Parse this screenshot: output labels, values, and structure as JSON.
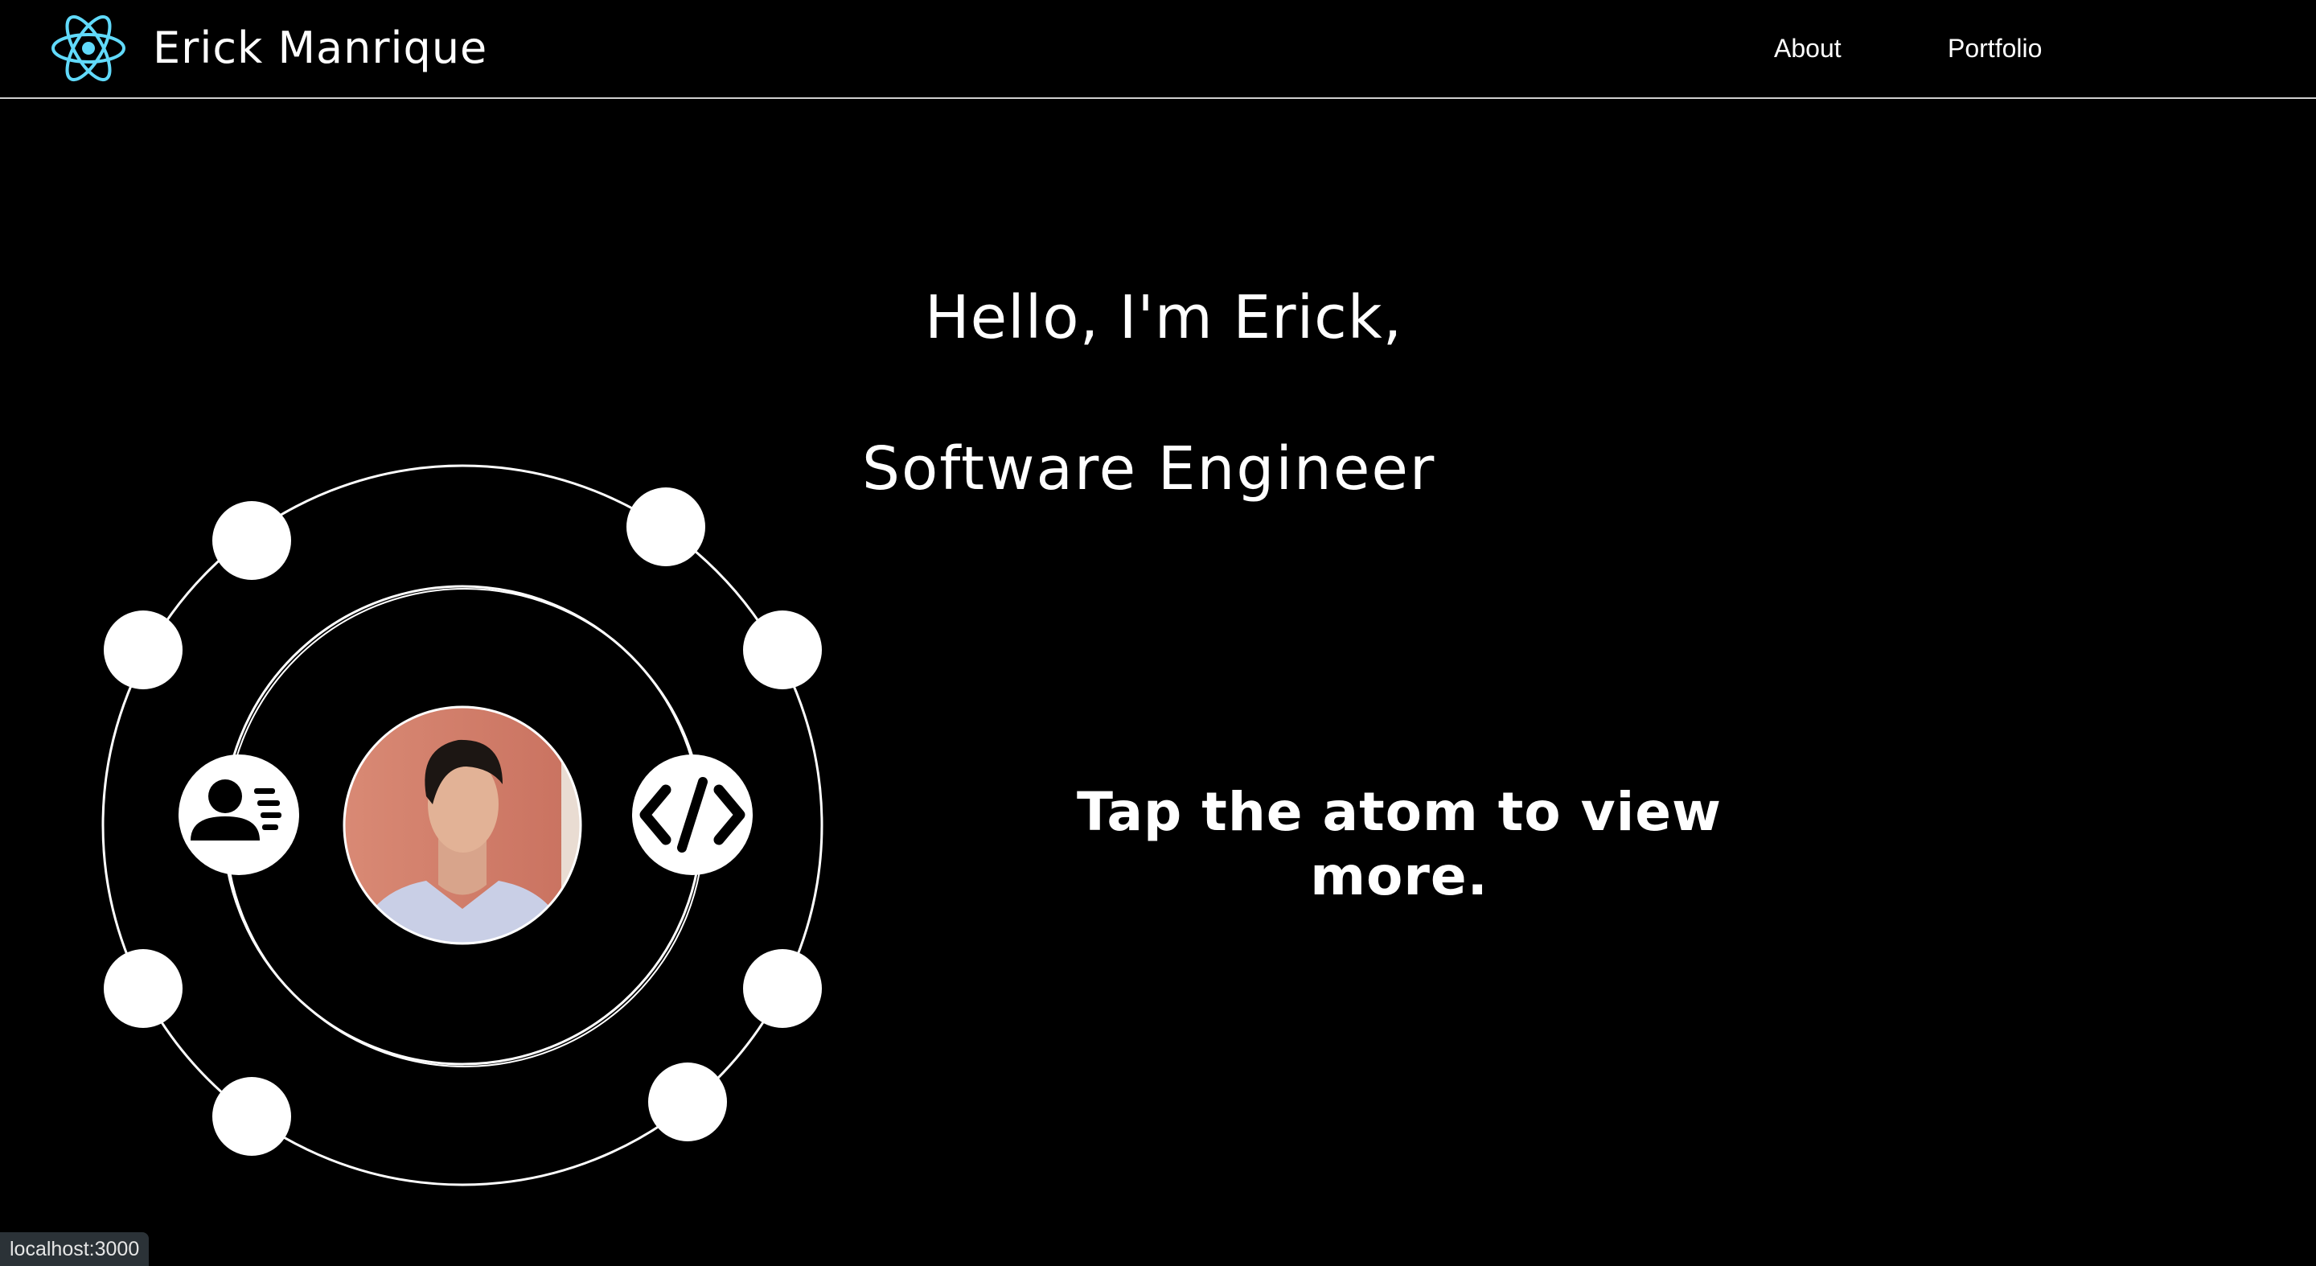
{
  "header": {
    "brand": "Erick Manrique",
    "logo_icon": "atom-logo-icon",
    "nav": [
      {
        "label": "About"
      },
      {
        "label": "Portfolio"
      }
    ]
  },
  "hero": {
    "greeting": "Hello, I'm Erick,",
    "role": "Software Engineer",
    "tap_prompt": "Tap the atom to view more."
  },
  "atom": {
    "center_icon": "profile-photo",
    "left_icon": "contact-card-icon",
    "right_icon": "code-icon"
  },
  "status_bar": {
    "url": "localhost:3000"
  },
  "colors": {
    "background": "#000000",
    "text": "#ffffff",
    "logo_accent": "#61dafb",
    "status_bg": "#2b3237"
  }
}
